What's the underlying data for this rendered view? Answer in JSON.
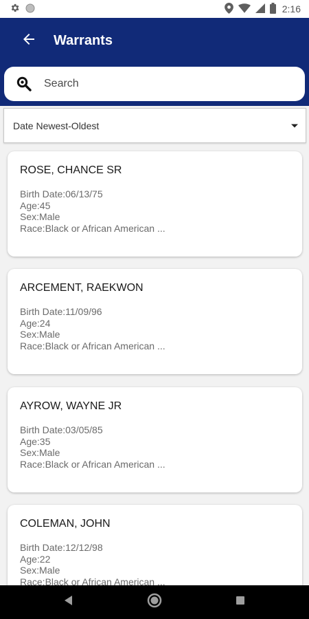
{
  "status_bar": {
    "time": "2:16",
    "icons": [
      "gear-icon",
      "circle-icon",
      "location-icon",
      "wifi-icon",
      "signal-icon",
      "battery-icon"
    ]
  },
  "app_bar": {
    "title": "Warrants",
    "back_icon": "arrow-back-icon",
    "background_color": "#112a78"
  },
  "search": {
    "placeholder": "Search",
    "value": ""
  },
  "sort": {
    "selected": "Date Newest-Oldest"
  },
  "warrants": [
    {
      "name": "ROSE, CHANCE SR",
      "birth_date": "Birth Date:06/13/75",
      "age": "Age:45",
      "sex": "Sex:Male",
      "race": "Race:Black or African American ..."
    },
    {
      "name": "ARCEMENT, RAEKWON",
      "birth_date": "Birth Date:11/09/96",
      "age": "Age:24",
      "sex": "Sex:Male",
      "race": "Race:Black or African American ..."
    },
    {
      "name": "AYROW, WAYNE JR",
      "birth_date": "Birth Date:03/05/85",
      "age": "Age:35",
      "sex": "Sex:Male",
      "race": "Race:Black or African American ..."
    },
    {
      "name": "COLEMAN, JOHN",
      "birth_date": "Birth Date:12/12/98",
      "age": "Age:22",
      "sex": "Sex:Male",
      "race": "Race:Black or African American ..."
    }
  ],
  "nav_bar": {
    "icons": [
      "nav-back-icon",
      "nav-home-icon",
      "nav-recents-icon"
    ]
  }
}
